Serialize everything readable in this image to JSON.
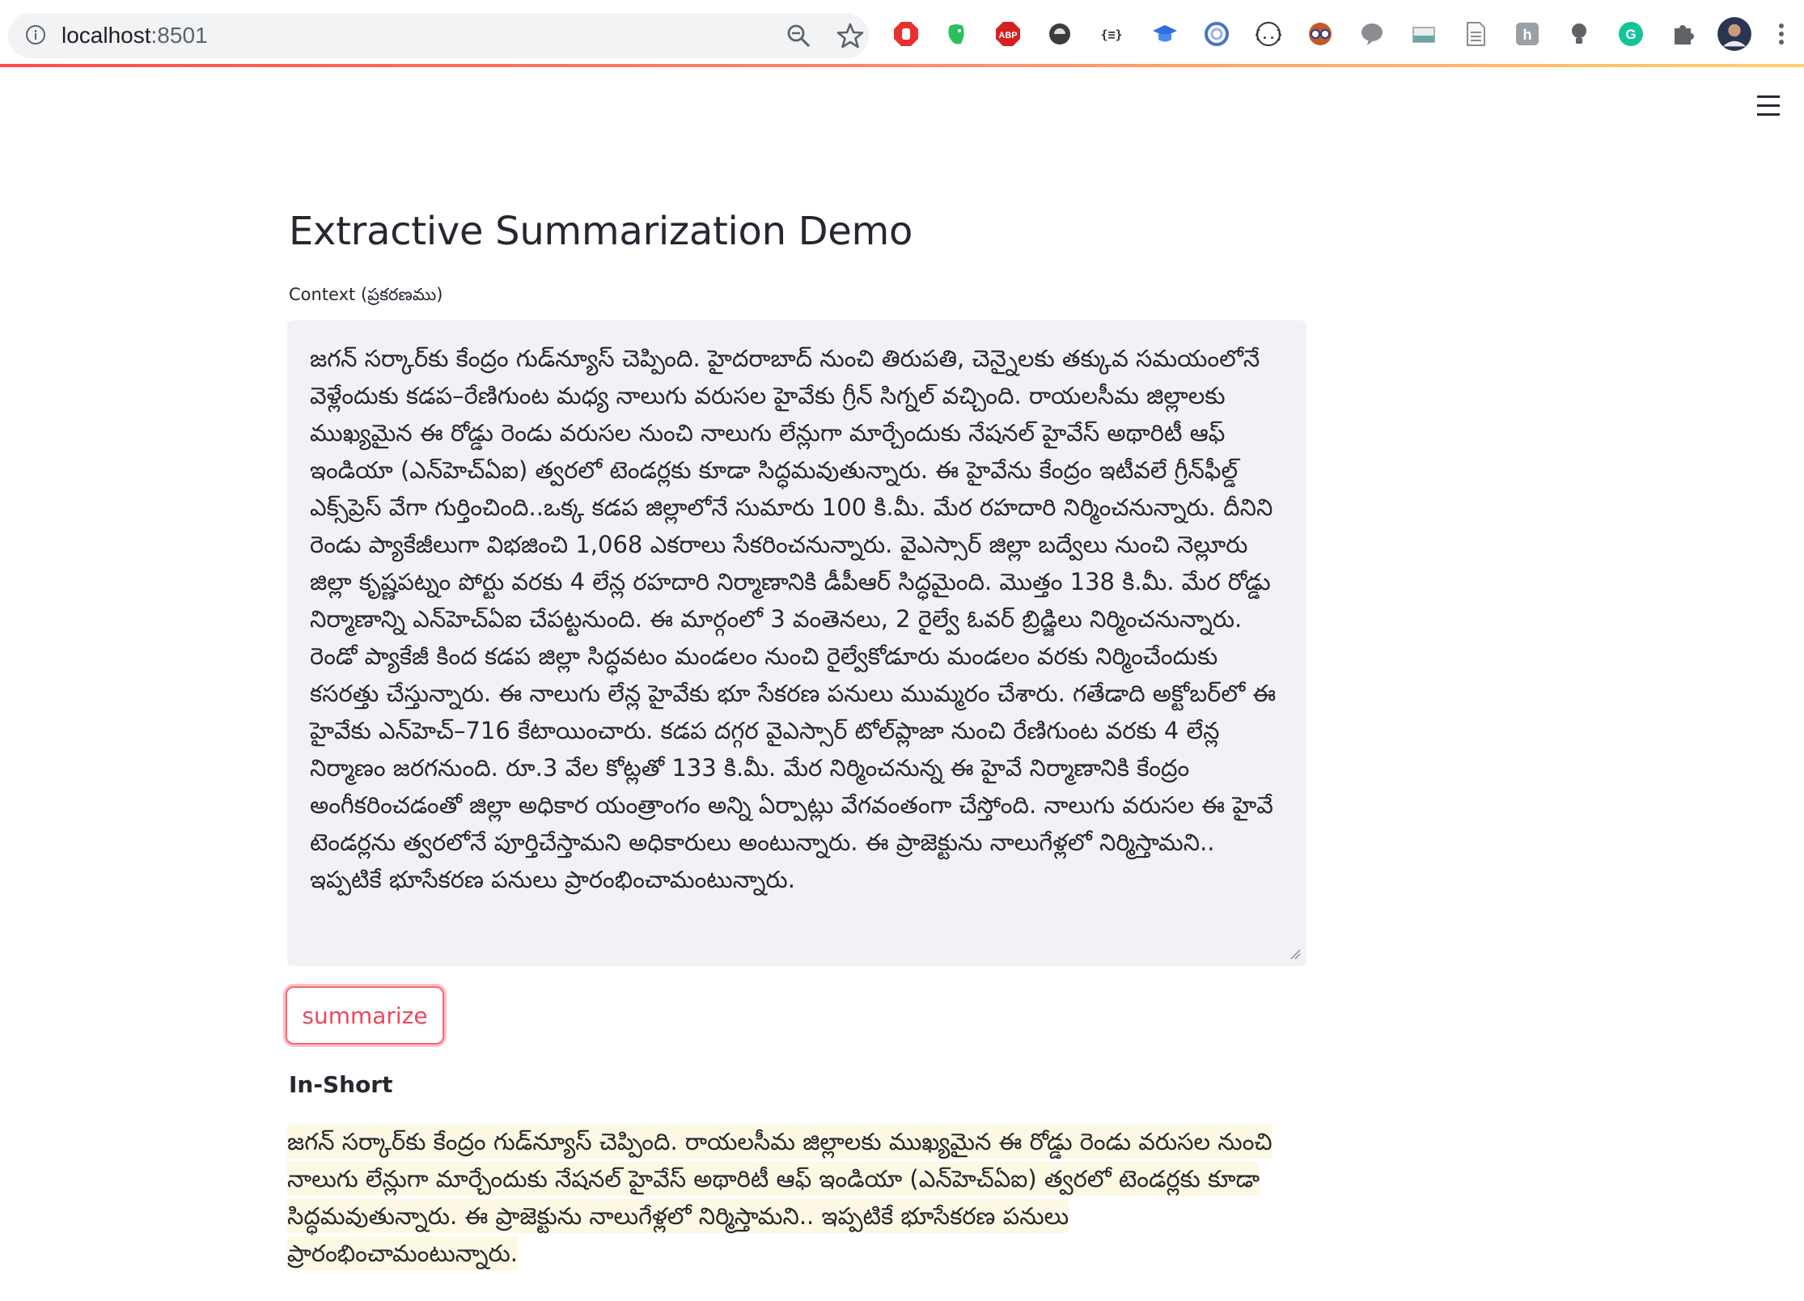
{
  "browser": {
    "url_host": "localhost",
    "url_port": ":8501",
    "extensions": [
      {
        "name": "adblock-stop-icon",
        "color": "#e8312f"
      },
      {
        "name": "evernote-icon",
        "color": "#2dbe60"
      },
      {
        "name": "abp-icon",
        "color": "#d5211f",
        "label": "ABP"
      },
      {
        "name": "dark-circle-icon",
        "color": "#3c3c3c"
      },
      {
        "name": "json-viewer-icon",
        "color": "#333333",
        "label": "{≡}"
      },
      {
        "name": "graduation-cap-icon",
        "color": "#2f6fe0"
      },
      {
        "name": "swirl-icon",
        "color": "#4a74c9"
      },
      {
        "name": "code-brackets-icon",
        "color": "#333333",
        "label": "{..}"
      },
      {
        "name": "owl-glasses-icon",
        "color": "#c15a2b"
      },
      {
        "name": "speech-bubble-icon",
        "color": "#8a8d91"
      },
      {
        "name": "page-ruler-icon",
        "color": "#6aa8a8"
      },
      {
        "name": "document-icon",
        "color": "#8a8d91"
      },
      {
        "name": "h-tag-icon",
        "color": "#9aa0a6",
        "label": "h"
      },
      {
        "name": "lightbulb-icon",
        "color": "#5f6368"
      },
      {
        "name": "grammarly-icon",
        "color": "#15c39a",
        "label": "G"
      },
      {
        "name": "puzzle-extensions-icon",
        "color": "#5f6368"
      },
      {
        "name": "profile-avatar-icon",
        "color": "#2a3550"
      },
      {
        "name": "browser-menu-icon",
        "color": "#5f6368"
      }
    ]
  },
  "app": {
    "title": "Extractive Summarization Demo",
    "context_label": "Context (ప్రకరణము)",
    "context_text": "జగన్ సర్కార్‌కు కేంద్రం గుడ్‌న్యూస్ చెప్పింది. హైదరాబాద్ నుంచి తిరుపతి, చెన్నైలకు తక్కువ సమయంలోనే వెళ్లేందుకు కడప–రేణిగుంట మధ్య నాలుగు వరుసల హైవేకు గ్రీన్ సిగ్నల్ వచ్చింది. రాయలసీమ జిల్లాలకు ముఖ్యమైన ఈ రోడ్డు రెండు వరుసల నుంచి నాలుగు లేన్లుగా మార్చేందుకు నేషనల్ హైవేస్ అథారిటీ ఆఫ్ ఇండియా (ఎన్‌హెచ్‌ఏఐ) త్వరలో టెండర్లకు కూడా సిద్ధమవుతున్నారు. ఈ హైవేను కేంద్రం ఇటీవలే గ్రీన్‌ఫీల్డ్ ఎక్స్‌ప్రెస్ వేగా గుర్తించింది..ఒక్క కడప జిల్లాలోనే సుమారు 100 కి.మీ. మేర రహదారి నిర్మించనున్నారు. దీనిని రెండు ప్యాకేజీలుగా విభజించి 1,068 ఎకరాలు సేకరించనున్నారు. వైఎస్సార్ జిల్లా బద్వేలు నుంచి నెల్లూరు జిల్లా కృష్ణపట్నం పోర్టు వరకు 4 లేన్ల రహదారి నిర్మాణానికి డీపీఆర్ సిద్ధమైంది. మొత్తం 138 కి.మీ. మేర రోడ్డు నిర్మాణాన్ని ఎన్‌హెచ్‌ఏఐ చేపట్టనుంది. ఈ మార్గంలో 3 వంతెనలు, 2 రైల్వే ఓవర్ బ్రిడ్జిలు నిర్మించనున్నారు. రెండో ప్యాకేజీ కింద కడప జిల్లా సిద్ధవటం మండలం నుంచి రైల్వేకోడూరు మండలం వరకు నిర్మించేందుకు కసరత్తు చేస్తున్నారు. ఈ నాలుగు లేన్ల హైవేకు భూ సేకరణ పనులు ముమ్మరం చేశారు. గతేడాది అక్టోబర్‌లో ఈ హైవేకు ఎన్‌హెచ్–716 కేటాయించారు. కడప దగ్గర వైఎస్సార్ టోల్‌ప్లాజా నుంచి రేణిగుంట వరకు 4 లేన్ల నిర్మాణం జరగనుంది. రూ.3 వేల కోట్లతో 133 కి.మీ. మేర నిర్మించనున్న ఈ హైవే నిర్మాణానికి కేంద్రం అంగీకరించడంతో జిల్లా అధికార యంత్రాంగం అన్ని ఏర్పాట్లు వేగవంతంగా చేస్తోంది. నాలుగు వరుసల ఈ హైవే టెండర్లను త్వరలోనే పూర్తిచేస్తామని అధికారులు అంటున్నారు. ఈ ప్రాజెక్టును నాలుగేళ్లలో నిర్మిస్తామని.. ఇప్పటికే భూసేకరణ పనులు ప్రారంభించామంటున్నారు.",
    "button_label": "summarize",
    "summary_heading": "In-Short",
    "summary_text": " జగన్ సర్కార్‌కు కేంద్రం గుడ్‌న్యూస్ చెప్పింది. రాయలసీమ జిల్లాలకు ముఖ్యమైన ఈ రోడ్డు రెండు వరుసల నుంచి నాలుగు లేన్లుగా మార్చేందుకు నేషనల్ హైవేస్ అథారిటీ ఆఫ్ ఇండియా (ఎన్‌హెచ్‌ఏఐ) త్వరలో టెండర్లకు కూడా సిద్ధమవుతున్నారు. ఈ ప్రాజెక్టును నాలుగేళ్లలో నిర్మిస్తామని.. ఇప్పటికే భూసేకరణ పనులు ప్రారంభించామంటున్నారు. ",
    "accent_color": "#ff4b4b",
    "summary_highlight_color": "#fdf8e3"
  }
}
